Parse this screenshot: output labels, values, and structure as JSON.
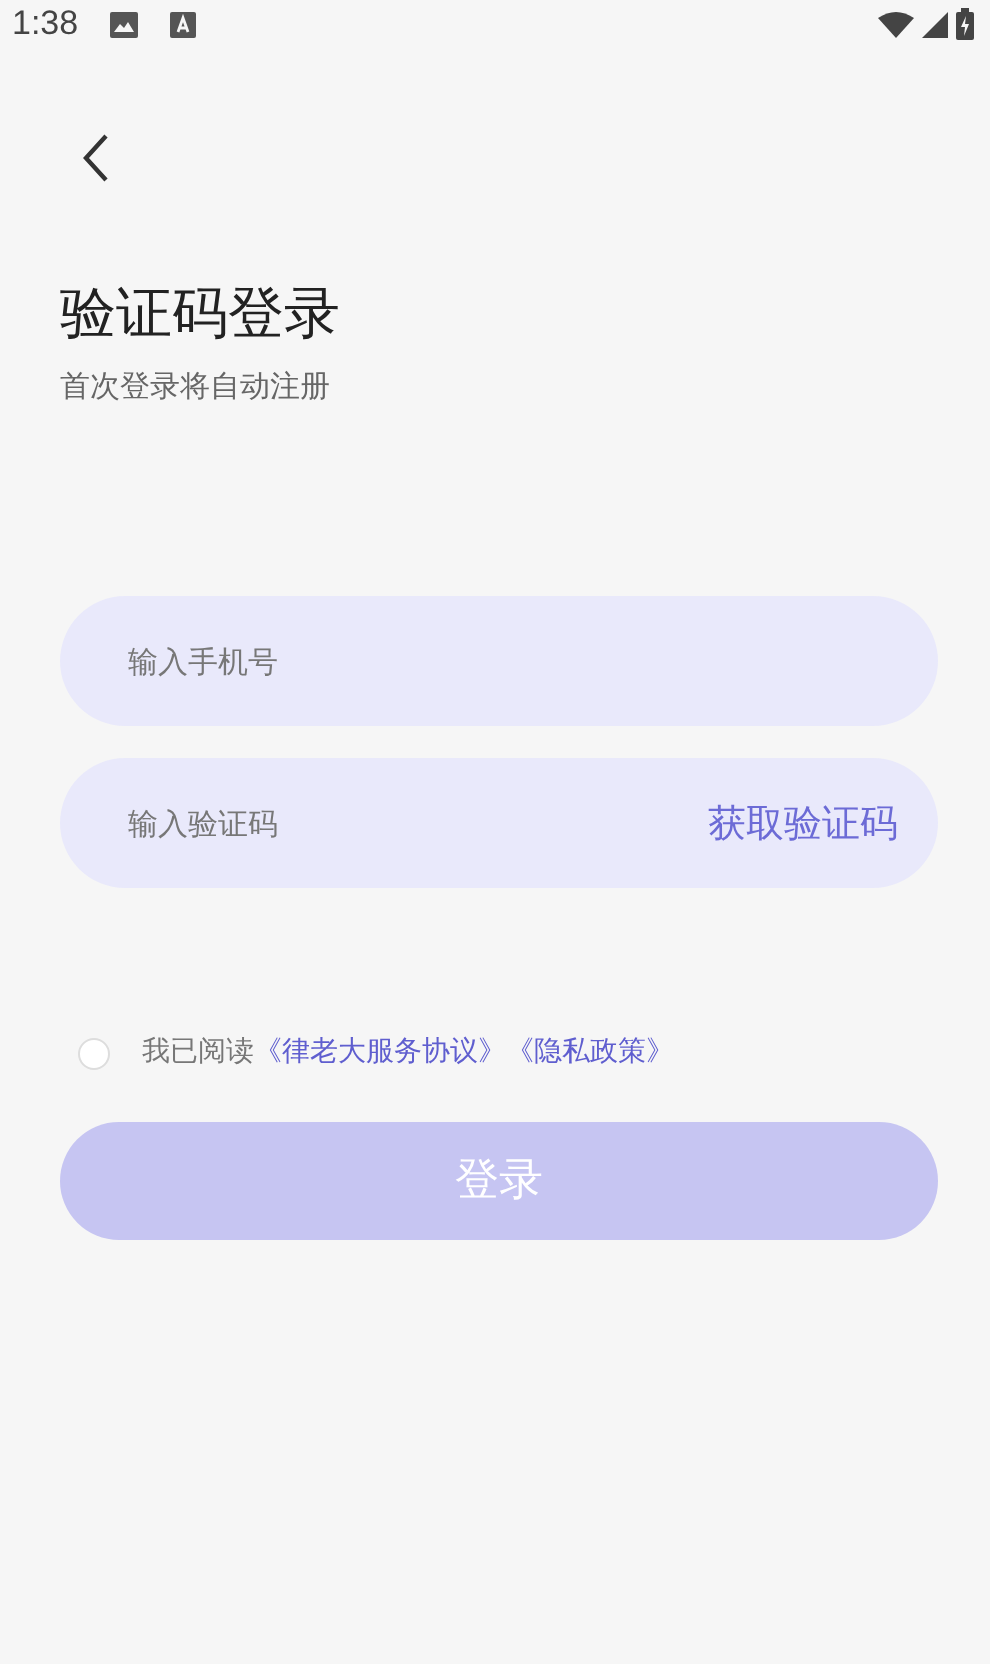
{
  "status_bar": {
    "time": "1:38"
  },
  "header": {
    "title": "验证码登录",
    "subtitle": "首次登录将自动注册"
  },
  "fields": [
    {
      "placeholder": "输入手机号"
    },
    {
      "placeholder": "输入验证码",
      "action": "获取验证码"
    }
  ],
  "agreement": {
    "checked": false,
    "text": "我已阅读",
    "links": [
      "《律老大服务协议》",
      "《隐私政策》"
    ]
  },
  "login_button": {
    "label": "登录",
    "disabled": true
  }
}
